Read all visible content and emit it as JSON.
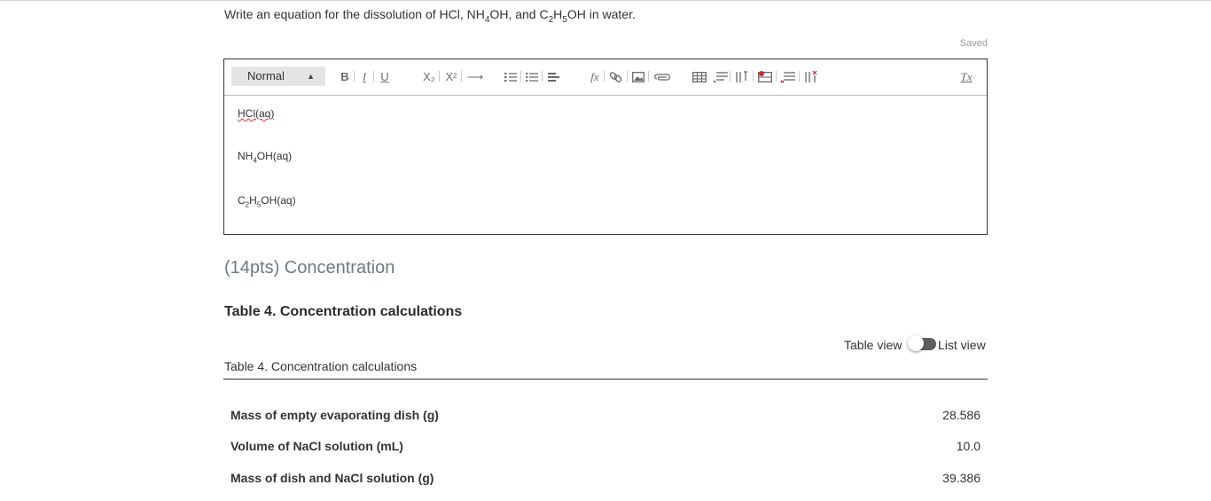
{
  "question": {
    "prompt_parts": [
      "Write an equation for the dissolution of HCl, NH",
      "4",
      "OH, and C",
      "2",
      "H",
      "5",
      "OH in water."
    ],
    "save_status": "Saved"
  },
  "editor": {
    "toolbar": {
      "format_select": "Normal",
      "bold": "B",
      "italic": "I",
      "underline": "U",
      "subscript": "X₂",
      "superscript": "X²",
      "arrow": "⟶",
      "formula": "fx",
      "clear_format": "Tx"
    },
    "content": {
      "line1": "HCl(aq)",
      "line2_parts": [
        "NH",
        "4",
        "OH(aq)"
      ],
      "line3_parts": [
        "C",
        "2",
        "H",
        "5",
        "OH(aq)"
      ]
    }
  },
  "section": {
    "title": "(14pts) Concentration"
  },
  "table": {
    "heading": "Table 4. Concentration calculations",
    "view_toggle": {
      "left_label": "Table view",
      "right_label": "List view",
      "selected": "List view"
    },
    "caption": "Table 4. Concentration calculations",
    "rows": [
      {
        "label": "Mass of empty evaporating dish (g)",
        "value": "28.586"
      },
      {
        "label": "Volume of NaCl solution (mL)",
        "value": "10.0"
      },
      {
        "label": "Mass of dish and NaCl solution (g)",
        "value": "39.386"
      }
    ]
  },
  "colors": {
    "section_title": "#6b7b82",
    "toggle_track": "#5f5f5f",
    "spellcheck": "#e03030"
  }
}
